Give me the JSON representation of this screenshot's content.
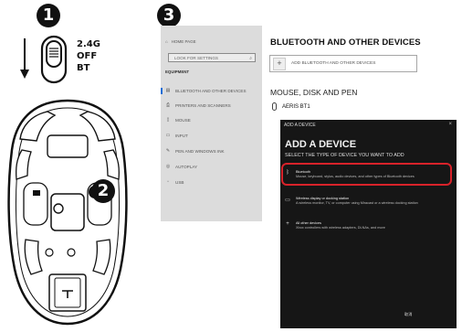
{
  "steps": {
    "one": "1",
    "two": "2",
    "three": "3"
  },
  "switch": {
    "labels": [
      "2.4G",
      "OFF",
      "BT"
    ]
  },
  "settings_panel": {
    "home": "HOME PAGE",
    "search_placeholder": "LOOK FOR SETTINGS",
    "category": "EQUIPMENT",
    "items": [
      {
        "label": "BLUETOOTH AND OTHER DEVICES",
        "icon": "bluetooth-devices-icon"
      },
      {
        "label": "PRINTERS AND SCANNERS",
        "icon": "printer-icon"
      },
      {
        "label": "MOUSE",
        "icon": "mouse-icon"
      },
      {
        "label": "INPUT",
        "icon": "keyboard-icon"
      },
      {
        "label": "PEN AND WINDOWS INK",
        "icon": "pen-icon"
      },
      {
        "label": "AUTOPLAY",
        "icon": "autoplay-icon"
      },
      {
        "label": "USB",
        "icon": "usb-icon"
      }
    ]
  },
  "bluetooth_page": {
    "heading": "BLUETOOTH AND OTHER DEVICES",
    "add_button": "ADD BLUETOOTH AND OTHER DEVICES",
    "section": "MOUSE, DISK AND PEN",
    "device_name": "AERIS BT1"
  },
  "add_device_dialog": {
    "window_title": "ADD A DEVICE",
    "close": "×",
    "heading": "ADD A DEVICE",
    "subheading": "SELECT THE TYPE OF DEVICE YOU WANT TO ADD",
    "options": [
      {
        "title": "Bluetooth",
        "desc": "Mouse, keyboard, stylus, audio devices, and other types of Bluetooth devices",
        "icon": "bluetooth-icon"
      },
      {
        "title": "Wireless display or docking station",
        "desc": "A wireless monitor, TV, or computer using Miracast or a wireless docking station",
        "icon": "monitor-icon"
      },
      {
        "title": "All other devices",
        "desc": "Xbox controllers with wireless adapters, DLNAs, and more",
        "icon": "plus-icon"
      }
    ],
    "cancel_button": "取消"
  },
  "colors": {
    "highlight": "#d8222a",
    "dialog_bg": "#161616",
    "panel_bg": "#dcdcdc",
    "accent": "#1a6ed6"
  }
}
